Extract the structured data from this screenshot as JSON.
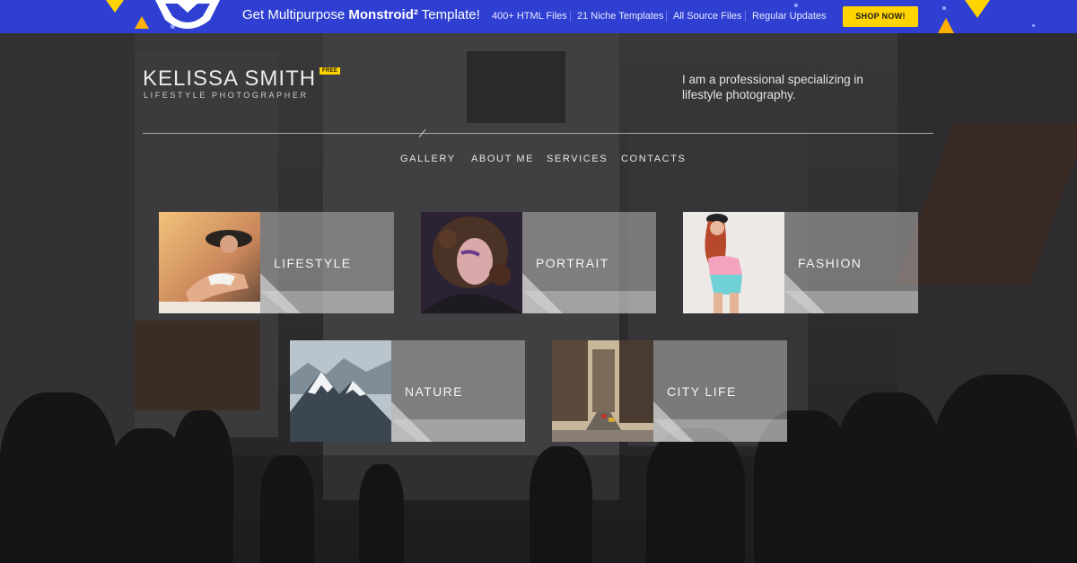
{
  "promo": {
    "headline_prefix": "Get Multipurpose ",
    "headline_brand": "Monstroid²",
    "headline_suffix": " Template!",
    "features": [
      "400+ HTML Files",
      "21 Niche Templates",
      "All Source Files",
      "Regular Updates"
    ],
    "cta_label": "SHOP NOW!",
    "colors": {
      "background": "#2f3fd2",
      "cta": "#ffd400"
    }
  },
  "header": {
    "brand_name": "KELISSA SMITH",
    "brand_badge": "FREE",
    "tagline": "LIFESTYLE PHOTOGRAPHER",
    "intro": "I am a professional specializing in lifestyle photography."
  },
  "nav": {
    "items": [
      {
        "label": "GALLERY"
      },
      {
        "label": "ABOUT ME"
      },
      {
        "label": "SERVICES"
      },
      {
        "label": "CONTACTS"
      }
    ]
  },
  "gallery": {
    "categories": [
      {
        "label": "LIFESTYLE",
        "icon": "lifestyle-photo"
      },
      {
        "label": "PORTRAIT",
        "icon": "portrait-photo"
      },
      {
        "label": "FASHION",
        "icon": "fashion-photo"
      },
      {
        "label": "NATURE",
        "icon": "mountain-photo"
      },
      {
        "label": "CITY LIFE",
        "icon": "city-street-photo"
      }
    ]
  }
}
